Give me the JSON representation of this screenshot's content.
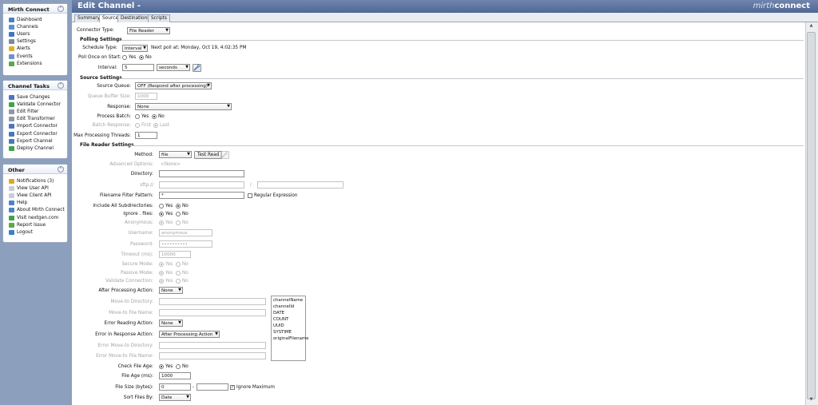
{
  "sidebar": {
    "mirth_connect": {
      "title": "Mirth Connect",
      "items": [
        {
          "label": "Dashboard",
          "icon": "dashboard-icon",
          "color": "#4a7fc1"
        },
        {
          "label": "Channels",
          "icon": "channels-icon",
          "color": "#5b8fd0"
        },
        {
          "label": "Users",
          "icon": "users-icon",
          "color": "#3f77c0"
        },
        {
          "label": "Settings",
          "icon": "settings-icon",
          "color": "#7b8aa3"
        },
        {
          "label": "Alerts",
          "icon": "alerts-icon",
          "color": "#e0b031"
        },
        {
          "label": "Events",
          "icon": "events-icon",
          "color": "#6c94c9"
        },
        {
          "label": "Extensions",
          "icon": "extensions-icon",
          "color": "#5aa84b"
        }
      ]
    },
    "channel_tasks": {
      "title": "Channel Tasks",
      "items": [
        {
          "label": "Save Changes",
          "icon": "save-icon",
          "color": "#4a78b8"
        },
        {
          "label": "Validate Connector",
          "icon": "validate-icon",
          "color": "#3fa34a"
        },
        {
          "label": "Edit Filter",
          "icon": "edit-filter-icon",
          "color": "#8e98a8"
        },
        {
          "label": "Edit Transformer",
          "icon": "edit-transformer-icon",
          "color": "#8e98a8"
        },
        {
          "label": "Import Connector",
          "icon": "import-icon",
          "color": "#4a78b8"
        },
        {
          "label": "Export Connector",
          "icon": "export-icon",
          "color": "#4a78b8"
        },
        {
          "label": "Export Channel",
          "icon": "export-channel-icon",
          "color": "#4a78b8"
        },
        {
          "label": "Deploy Channel",
          "icon": "deploy-icon",
          "color": "#3fa34a"
        }
      ]
    },
    "other": {
      "title": "Other",
      "items": [
        {
          "label": "Notifications (3)",
          "icon": "notifications-icon",
          "color": "#e0a531"
        },
        {
          "label": "View User API",
          "icon": "user-api-icon",
          "color": "#c8ced8"
        },
        {
          "label": "View Client API",
          "icon": "client-api-icon",
          "color": "#c8ced8"
        },
        {
          "label": "Help",
          "icon": "help-icon",
          "color": "#4c82c9"
        },
        {
          "label": "About Mirth Connect",
          "icon": "about-icon",
          "color": "#4c82c9"
        },
        {
          "label": "Visit nextgen.com",
          "icon": "web-icon",
          "color": "#3fa34a"
        },
        {
          "label": "Report Issue",
          "icon": "report-issue-icon",
          "color": "#5aa84b"
        },
        {
          "label": "Logout",
          "icon": "logout-icon",
          "color": "#3e7fc4"
        }
      ]
    },
    "collapse_glyph": "⌃"
  },
  "header": {
    "title": "Edit Channel -",
    "logo_part1": "mirth",
    "logo_part2": "connect"
  },
  "tabs": [
    "Summary",
    "Source",
    "Destinations",
    "Scripts"
  ],
  "active_tab": "Source",
  "form": {
    "connector_type_label": "Connector Type:",
    "connector_type_value": "File Reader",
    "polling": {
      "section_title": "Polling Settings",
      "schedule_type_label": "Schedule Type:",
      "schedule_type_value": "Interval",
      "next_poll_text": "Next poll at: Monday, Oct 19, 4:02:35 PM",
      "poll_once_label": "Poll Once on Start:",
      "poll_once_yes": "Yes",
      "poll_once_no": "No",
      "interval_label": "Interval:",
      "interval_value": "5",
      "interval_unit": "seconds"
    },
    "source": {
      "section_title": "Source Settings",
      "source_queue_label": "Source Queue:",
      "source_queue_value": "OFF (Respond after processing)",
      "queue_buffer_label": "Queue Buffer Size:",
      "queue_buffer_value": "1000",
      "response_label": "Response:",
      "response_value": "None",
      "process_batch_label": "Process Batch:",
      "process_batch_yes": "Yes",
      "process_batch_no": "No",
      "batch_response_label": "Batch Response:",
      "batch_response_first": "First",
      "batch_response_last": "Last",
      "max_threads_label": "Max Processing Threads:",
      "max_threads_value": "1"
    },
    "file_reader": {
      "section_title": "File Reader Settings",
      "method_label": "Method:",
      "method_value": "file",
      "test_read_label": "Test Read",
      "advanced_options_label": "Advanced Options:",
      "advanced_options_value": "<None>",
      "directory_label": "Directory:",
      "directory_value": "",
      "sftp_label": "sftp://",
      "sftp_sep": "/",
      "filename_filter_label": "Filename Filter Pattern:",
      "filename_filter_value": "*",
      "regex_label": "Regular Expression",
      "include_subdirs_label": "Include All Subdirectories:",
      "ignore_label": "Ignore . files:",
      "anonymous_label": "Anonymous:",
      "username_label": "Username:",
      "username_value": "anonymous",
      "password_label": "Password:",
      "password_value": "••••••••••",
      "timeout_label": "Timeout (ms):",
      "timeout_value": "10000",
      "secure_mode_label": "Secure Mode:",
      "passive_mode_label": "Passive Mode:",
      "validate_connection_label": "Validate Connection:",
      "after_processing_label": "After Processing Action:",
      "after_processing_value": "None",
      "move_to_dir_label": "Move-to Directory:",
      "move_to_file_label": "Move-to File Name:",
      "error_reading_label": "Error Reading Action:",
      "error_reading_value": "None",
      "error_response_label": "Error in Response Action:",
      "error_response_value": "After Processing Action",
      "error_move_dir_label": "Error Move-to Directory:",
      "error_move_file_label": "Error Move-to File Name:",
      "check_file_age_label": "Check File Age:",
      "file_age_label": "File Age (ms):",
      "file_age_value": "1000",
      "file_size_label": "File Size (bytes):",
      "file_size_min": "0",
      "file_size_dash": "-",
      "file_size_max": "",
      "ignore_max_label": "Ignore Maximum",
      "sort_files_label": "Sort Files By:",
      "sort_files_value": "Date",
      "yes": "Yes",
      "no": "No",
      "variables": [
        "channelName",
        "channelId",
        "DATE",
        "COUNT",
        "UUID",
        "SYSTIME",
        "originalFilename"
      ]
    }
  }
}
